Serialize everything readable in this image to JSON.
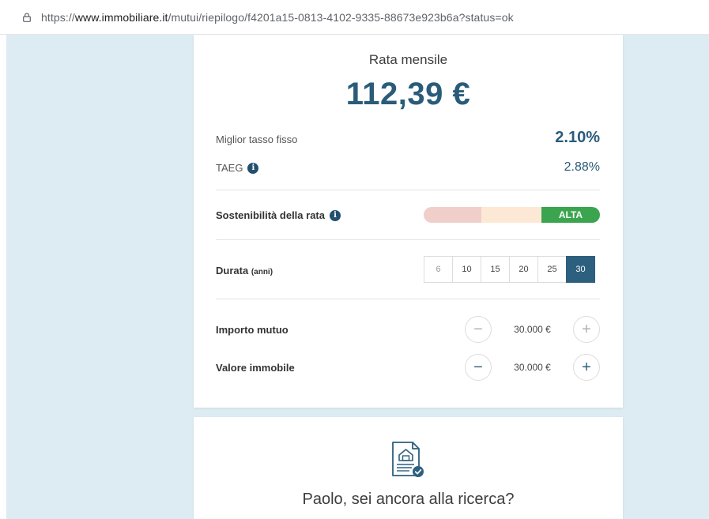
{
  "browser": {
    "url_prefix": "https://",
    "url_domain": "www.immobiliare.it",
    "url_path": "/mutui/riepilogo/f4201a15-0813-4102-9335-88673e923b6a?status=ok"
  },
  "summary": {
    "rata_title": "Rata mensile",
    "rata_value": "112,39 €",
    "tasso_label": "Miglior tasso fisso",
    "tasso_value": "2.10%",
    "taeg_label": "TAEG",
    "taeg_value": "2.88%",
    "info_glyph": "i"
  },
  "sostenibilita": {
    "label": "Sostenibilità della rata",
    "level_label": "ALTA",
    "colors": {
      "low": "#f0cfcb",
      "mid": "#fde8d6",
      "high": "#3aa54e"
    }
  },
  "durata": {
    "label": "Durata",
    "unit": "(anni)",
    "options": [
      "6",
      "10",
      "15",
      "20",
      "25",
      "30"
    ],
    "selected": "30"
  },
  "importo": {
    "label": "Importo mutuo",
    "value": "30.000 €",
    "minus": "−",
    "plus": "+"
  },
  "valore": {
    "label": "Valore immobile",
    "value": "30.000 €",
    "minus": "−",
    "plus": "+"
  },
  "promo": {
    "title": "Paolo, sei ancora alla ricerca?",
    "icon": "document-house-check-icon"
  },
  "colors": {
    "accent": "#2a5c7a",
    "background": "#dcecf2"
  }
}
